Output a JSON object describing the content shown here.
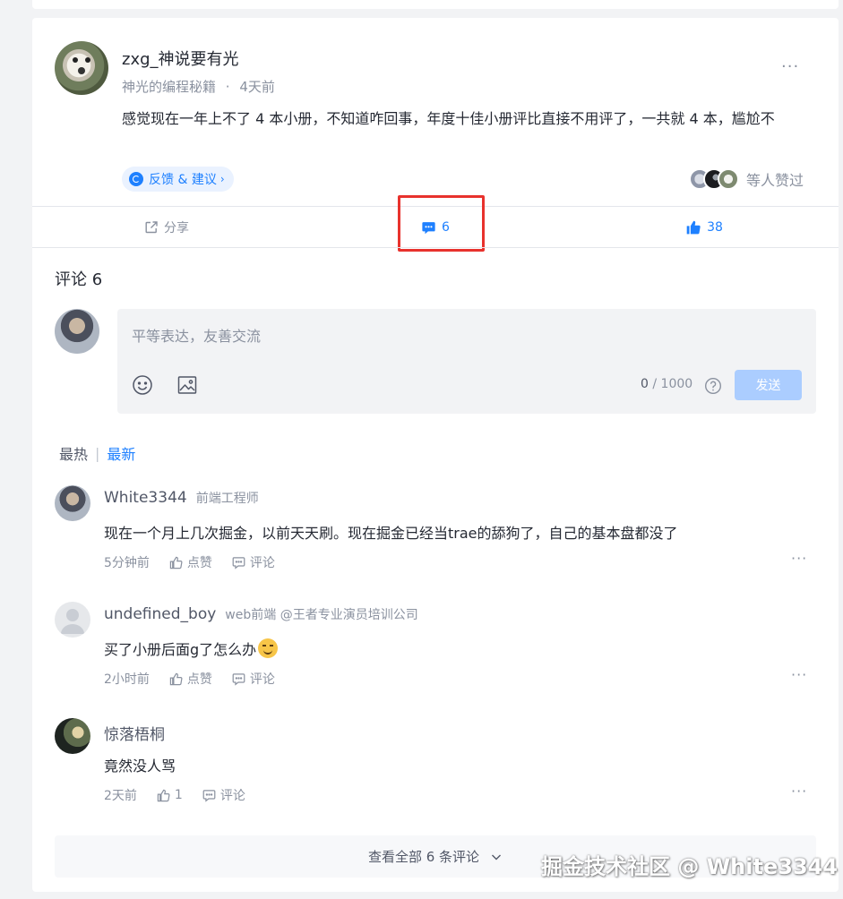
{
  "post": {
    "author_name": "zxg_神说要有光",
    "author_column": "神光的编程秘籍",
    "meta_sep": "·",
    "time": "4天前",
    "more": "···",
    "text": "感觉现在一年上不了 4 本小册，不知道咋回事，年度十佳小册评比直接不用评了，一共就 4 本，尴尬不",
    "tag_label": "反馈 & 建议",
    "tag_chevron": "›",
    "likers_text": "等人赞过",
    "actions": {
      "share_label": "分享",
      "comment_count": "6",
      "like_count": "38"
    }
  },
  "comments_section": {
    "title": "评论 6",
    "editor": {
      "placeholder": "平等表达，友善交流",
      "char_count": "0",
      "char_sep": " / ",
      "char_max": "1000",
      "send_label": "发送"
    },
    "sort": {
      "hot": "最热",
      "sep": "|",
      "new": "最新"
    }
  },
  "comments": [
    {
      "name": "White3344",
      "title": "前端工程师",
      "text": "现在一个月上几次掘金，以前天天刷。现在掘金已经当trae的舔狗了，自己的基本盘都没了",
      "time": "5分钟前",
      "like_label": "点赞",
      "reply_label": "评论",
      "more": "···"
    },
    {
      "name": "undefined_boy",
      "title": "web前端 @王者专业演员培训公司",
      "text": "买了小册后面g了怎么办",
      "time": "2小时前",
      "like_label": "点赞",
      "reply_label": "评论",
      "more": "···"
    },
    {
      "name": "惊落梧桐",
      "title": "",
      "text": "竟然没人骂",
      "time": "2天前",
      "like_label": "1",
      "reply_label": "评论",
      "more": "···"
    }
  ],
  "view_all_label": "查看全部 6 条评论",
  "watermark": "掘金技术社区 @ White3344",
  "colors": {
    "brand_blue": "#1e80ff",
    "highlight_red": "#e8322d",
    "send_disabled": "#abcdff"
  },
  "icons": {
    "share": "share-icon",
    "comment": "comment-bubble-icon",
    "like": "thumbs-up-icon",
    "emoji": "smiley-icon",
    "image": "image-icon",
    "help": "question-icon",
    "chevron": "chevron-down-icon"
  }
}
